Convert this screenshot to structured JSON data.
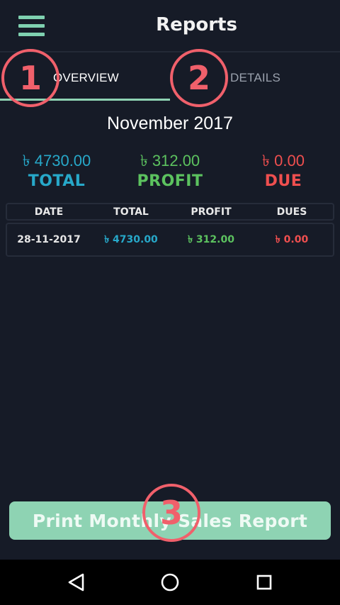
{
  "header": {
    "title": "Reports",
    "menu_icon": "hamburger-menu-icon"
  },
  "tabs": [
    {
      "label": "OVERVIEW",
      "selected": true
    },
    {
      "label": "DETAILS",
      "selected": false
    }
  ],
  "period": "November 2017",
  "summary": {
    "total": {
      "amount": "৳ 4730.00",
      "label": "TOTAL",
      "color": "#27a8c9"
    },
    "profit": {
      "amount": "৳ 312.00",
      "label": "PROFIT",
      "color": "#5cc25f"
    },
    "due": {
      "amount": "৳ 0.00",
      "label": "DUE",
      "color": "#ef4f4f"
    }
  },
  "table": {
    "columns": [
      "DATE",
      "TOTAL",
      "PROFIT",
      "DUES"
    ],
    "rows": [
      {
        "date": "28-11-2017",
        "total": "৳ 4730.00",
        "profit": "৳ 312.00",
        "dues": "৳ 0.00"
      }
    ]
  },
  "print_button": {
    "label": "Print Monthly Sales Report",
    "color": "#8ed3b3"
  },
  "callouts": [
    "1",
    "2",
    "3"
  ],
  "nav": {
    "back_icon": "back-triangle-icon",
    "home_icon": "home-circle-icon",
    "recent_icon": "recent-apps-square-icon"
  },
  "colors": {
    "background": "#161b27",
    "accent": "#8ed3b3",
    "callout": "#f0606b"
  }
}
